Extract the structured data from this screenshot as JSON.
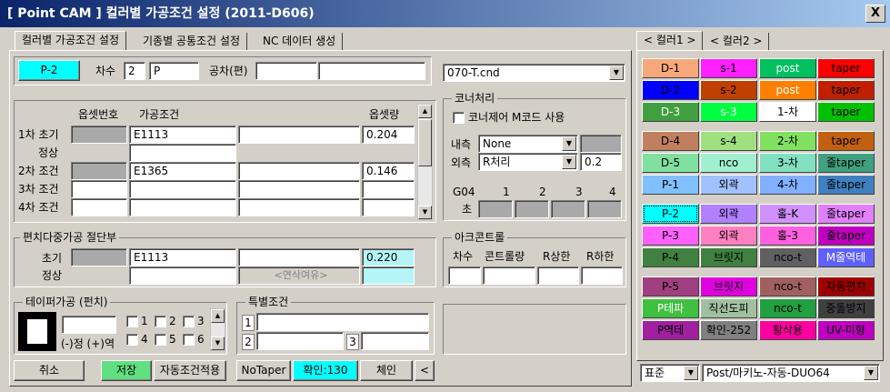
{
  "window": {
    "title": "[ Point CAM ]  컬러별 가공조건 설정  (2011-D606)",
    "close_label": "X"
  },
  "tabs": [
    "컬러별 가공조건 설정",
    "기종별 공통조건 설정",
    "NC 데이터 생성"
  ],
  "top": {
    "current_color": "P-2",
    "order_label": "차수",
    "order_value": "2",
    "order_mode": "P",
    "tolerance_label": "공차(편)",
    "tolerance_value": "",
    "tolerance_value2": ""
  },
  "file_select": "070-T.cnd",
  "conditions": {
    "headers": {
      "offset": "옵셋번호",
      "cond": "가공조건",
      "amount": "옵셋량"
    },
    "rows": [
      {
        "label": "1차 초기",
        "offset": "",
        "cond": "E1113",
        "extra": "",
        "amount": "0.204"
      },
      {
        "label": "정상",
        "offset": "",
        "cond": "",
        "extra": "",
        "amount": ""
      },
      {
        "label": "2차 조건",
        "offset": "",
        "cond": "E1365",
        "extra": "",
        "amount": "0.146"
      },
      {
        "label": "3차 조건",
        "offset": "",
        "cond": "",
        "extra": "",
        "amount": ""
      },
      {
        "label": "4차 조건",
        "offset": "",
        "cond": "",
        "extra": "",
        "amount": ""
      }
    ]
  },
  "deviation": {
    "title": "편치다중가공 절단부",
    "row1_label": "초기",
    "row1_cond": "E1113",
    "row1_amount": "0.220",
    "row2_label": "정상",
    "row2_note": "<연삭여유>"
  },
  "corner": {
    "title": "코너처리",
    "check_label": "코너제어 M코드 사용",
    "inner_label": "내측",
    "inner_value": "None",
    "outer_label": "외측",
    "outer_value": "R처리",
    "outer_num": "0.2",
    "g04_label": "G04",
    "g04_cols": [
      "1",
      "2",
      "3",
      "4"
    ],
    "sec_label": "초"
  },
  "arc": {
    "title": "아크콘트롤",
    "headers": [
      "차수",
      "콘트롤량",
      "R상한",
      "R하한"
    ]
  },
  "taper": {
    "title": "테이퍼가공 (펀치)",
    "sign_label": "(-)정 (+)역",
    "checks": [
      "1",
      "2",
      "3",
      "4",
      "5",
      "6"
    ]
  },
  "special": {
    "title": "특별조건",
    "row1": "1",
    "row2": "2",
    "row3": "3"
  },
  "buttons": {
    "cancel": "취소",
    "save": "저장",
    "auto": "자동조건적용",
    "notaper": "NoTaper",
    "confirm": "확인:130",
    "change": "체인",
    "back": "<"
  },
  "color_tabs": [
    "< 컬러1 >",
    "< 컬러2 >"
  ],
  "colors": [
    {
      "label": "D-1",
      "bg": "#f7a87b",
      "fg": "#000000"
    },
    {
      "label": "s-1",
      "bg": "#ff1fff",
      "fg": "#000000"
    },
    {
      "label": "post",
      "bg": "#00c060",
      "fg": "#ffffff"
    },
    {
      "label": "taper",
      "bg": "#ff0000",
      "fg": "#000000"
    },
    {
      "label": "D-2",
      "bg": "#0000ff",
      "fg": "#000000"
    },
    {
      "label": "s-2",
      "bg": "#c04000",
      "fg": "#000000"
    },
    {
      "label": "post",
      "bg": "#ff8000",
      "fg": "#ffffff"
    },
    {
      "label": "taper",
      "bg": "#c02000",
      "fg": "#000000"
    },
    {
      "label": "D-3",
      "bg": "#40a040",
      "fg": "#ffffff"
    },
    {
      "label": "s-3",
      "bg": "#00ff40",
      "fg": "#ffffff"
    },
    {
      "label": "1-차",
      "bg": "#ffffff",
      "fg": "#000000"
    },
    {
      "label": "taper",
      "bg": "#00c000",
      "fg": "#000000"
    },
    {
      "label": "D-4",
      "bg": "#c08060",
      "fg": "#000000"
    },
    {
      "label": "s-4",
      "bg": "#a0e080",
      "fg": "#000000"
    },
    {
      "label": "2-차",
      "bg": "#80e060",
      "fg": "#000000"
    },
    {
      "label": "taper",
      "bg": "#c06010",
      "fg": "#000000"
    },
    {
      "label": "D-5",
      "bg": "#80e0a0",
      "fg": "#000000"
    },
    {
      "label": "nco",
      "bg": "#a0f0d0",
      "fg": "#000000"
    },
    {
      "label": "3-차",
      "bg": "#80e0c0",
      "fg": "#000000"
    },
    {
      "label": "줄taper",
      "bg": "#40a080",
      "fg": "#000000"
    },
    {
      "label": "P-1",
      "bg": "#80c0ff",
      "fg": "#000000"
    },
    {
      "label": "외곽",
      "bg": "#a0c0ff",
      "fg": "#000000"
    },
    {
      "label": "4-차",
      "bg": "#80b0ff",
      "fg": "#000000"
    },
    {
      "label": "줄taper",
      "bg": "#4080c0",
      "fg": "#000000"
    },
    {
      "label": "P-2",
      "bg": "#00ffff",
      "fg": "#000000"
    },
    {
      "label": "외곽",
      "bg": "#b080ff",
      "fg": "#000000"
    },
    {
      "label": "홀-K",
      "bg": "#d090ff",
      "fg": "#000000"
    },
    {
      "label": "줄taper",
      "bg": "#e080ff",
      "fg": "#000000"
    },
    {
      "label": "P-3",
      "bg": "#ff60ff",
      "fg": "#000000"
    },
    {
      "label": "외곽",
      "bg": "#ff80c0",
      "fg": "#000000"
    },
    {
      "label": "홀-3",
      "bg": "#ff60e0",
      "fg": "#000000"
    },
    {
      "label": "줄taper",
      "bg": "#c000c0",
      "fg": "#000000"
    },
    {
      "label": "P-4",
      "bg": "#408040",
      "fg": "#000000"
    },
    {
      "label": "브릿지",
      "bg": "#408040",
      "fg": "#000000"
    },
    {
      "label": "nco-t",
      "bg": "#606060",
      "fg": "#000000"
    },
    {
      "label": "M줄역테",
      "bg": "#6060ff",
      "fg": "#ffffff"
    },
    {
      "label": "P-5",
      "bg": "#a04080",
      "fg": "#000000"
    },
    {
      "label": "브릿지",
      "bg": "#e000e0",
      "fg": "#000000"
    },
    {
      "label": "nco-t",
      "bg": "#a06060",
      "fg": "#000000"
    },
    {
      "label": "자동편치",
      "bg": "#a00000",
      "fg": "#000000"
    },
    {
      "label": "P테파",
      "bg": "#40c040",
      "fg": "#ffffff"
    },
    {
      "label": "직선도피",
      "bg": "#a0c0a0",
      "fg": "#000000"
    },
    {
      "label": "nco-t",
      "bg": "#20a040",
      "fg": "#000000"
    },
    {
      "label": "중돌방지",
      "bg": "#404040",
      "fg": "#000000"
    },
    {
      "label": "P역테",
      "bg": "#a020a0",
      "fg": "#000000"
    },
    {
      "label": "확인-252",
      "bg": "#808080",
      "fg": "#000000"
    },
    {
      "label": "황삭용",
      "bg": "#ff00a0",
      "fg": "#000000"
    },
    {
      "label": "UV-미형",
      "bg": "#c000c0",
      "fg": "#000000"
    }
  ],
  "bottom_right": {
    "std": "표준",
    "post": "Post/마키노-자동-DUO64"
  }
}
